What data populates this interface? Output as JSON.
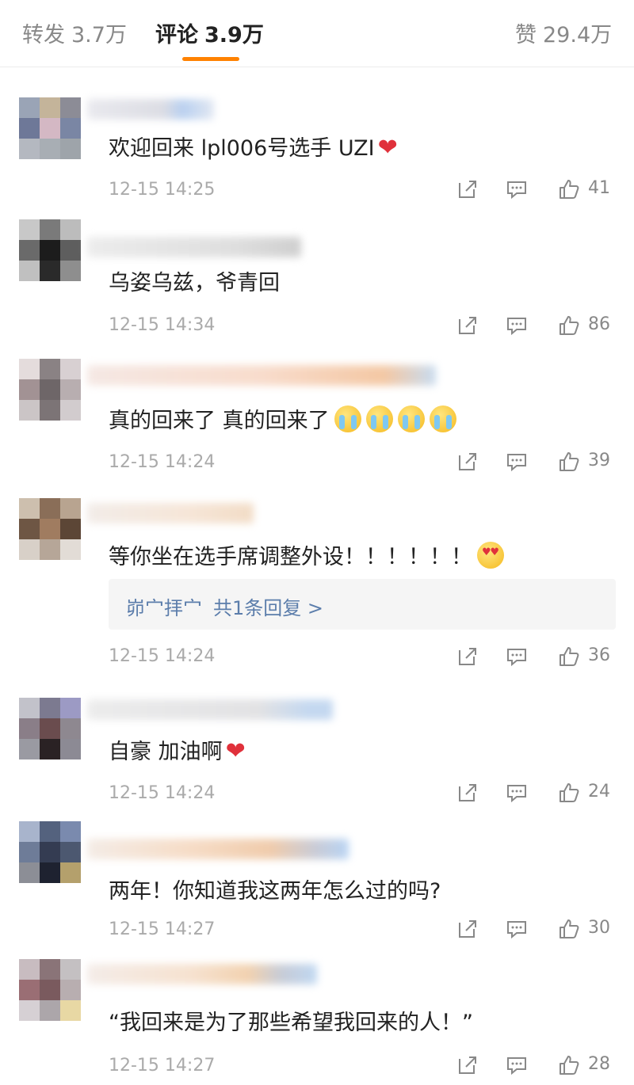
{
  "tabs": [
    {
      "label": "转发",
      "count": "3.7万"
    },
    {
      "label": "评论",
      "count": "3.9万"
    },
    {
      "label": "赞",
      "count": "29.4万"
    }
  ],
  "comments": [
    {
      "text": "欢迎回来 lpl006号选手 UZI",
      "timestamp": "12-15 14:25",
      "likes": "41"
    },
    {
      "text": "乌姿乌兹，爷青回",
      "timestamp": "12-15 14:34",
      "likes": "86"
    },
    {
      "text": "真的回来了 真的回来了",
      "timestamp": "12-15 14:24",
      "likes": "39"
    },
    {
      "text": "等你坐在选手席调整外设！！！！！！",
      "timestamp": "12-15 14:24",
      "likes": "36",
      "reply": {
        "name": "峁宀拝宀",
        "summary": "共1条回复 >"
      }
    },
    {
      "text": "自豪 加油啊",
      "timestamp": "12-15 14:24",
      "likes": "24"
    },
    {
      "text": "两年！你知道我这两年怎么过的吗?",
      "timestamp": "12-15 14:27",
      "likes": "30"
    },
    {
      "text": "“我回来是为了那些希望我回来的人！”",
      "timestamp": "12-15 14:27",
      "likes": "28"
    }
  ],
  "icons": {
    "share": "share-icon",
    "reply": "comment-icon",
    "like": "thumbs-up-icon"
  },
  "colors": {
    "accent": "#ff8200",
    "link": "#5b7dab",
    "heart": "#e0313b"
  }
}
